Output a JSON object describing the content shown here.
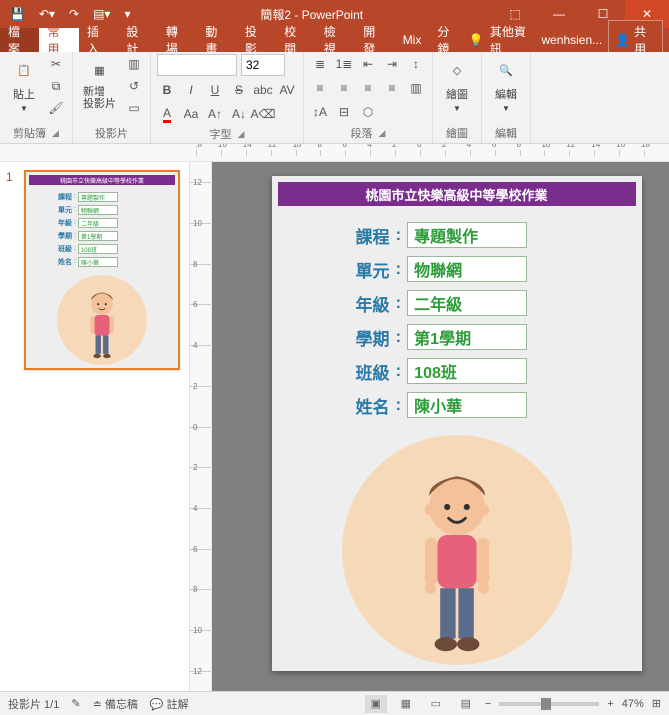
{
  "titlebar": {
    "app_title": "簡報2 - PowerPoint"
  },
  "tabs": {
    "file": "檔案",
    "home": "常用",
    "insert": "插入",
    "design": "設計",
    "transitions": "轉場",
    "animations": "動畫",
    "slideshow": "投影",
    "review": "校閱",
    "view": "檢視",
    "developer": "開發",
    "mix": "Mix",
    "addin": "分鏡",
    "tellme": "其他資訊",
    "user": "wenhsien...",
    "share": "共用"
  },
  "ribbon": {
    "clipboard": {
      "paste": "貼上",
      "label": "剪貼簿"
    },
    "slides": {
      "new_slide": "新增\n投影片",
      "label": "投影片"
    },
    "font": {
      "size": "32",
      "label": "字型"
    },
    "paragraph": {
      "label": "段落"
    },
    "drawing": {
      "draw": "繪圖",
      "label": "繪圖"
    },
    "editing": {
      "edit": "編輯",
      "label": "編輯"
    }
  },
  "slide": {
    "number": "1",
    "title": "桃園市立快樂高級中等學校作業",
    "rows": [
      {
        "label": "課程",
        "value": "專題製作"
      },
      {
        "label": "單元",
        "value": "物聯網"
      },
      {
        "label": "年級",
        "value": "二年級"
      },
      {
        "label": "學期",
        "value": "第1學期"
      },
      {
        "label": "班級",
        "value": "108班"
      },
      {
        "label": "姓名",
        "value": "陳小華"
      }
    ]
  },
  "status": {
    "slide_indicator": "投影片 1/1",
    "lang": "",
    "notes": "備忘稿",
    "comments": "註解",
    "zoom": "47%"
  },
  "ruler": {
    "hmarks": [
      "18",
      "16",
      "14",
      "12",
      "10",
      "8",
      "6",
      "4",
      "2",
      "0",
      "2",
      "4",
      "6",
      "8",
      "10",
      "12",
      "14",
      "16",
      "18"
    ],
    "vmarks": [
      "12",
      "10",
      "8",
      "6",
      "4",
      "2",
      "0",
      "2",
      "4",
      "6",
      "8",
      "10",
      "12"
    ]
  }
}
